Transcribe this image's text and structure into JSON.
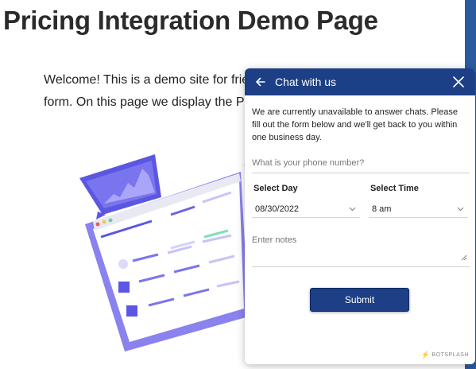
{
  "page": {
    "title": "Pricing Integration Demo Page",
    "intro_line1": "Welcome! This is a demo site for frie",
    "intro_line2": "form. On this page we display the Pr"
  },
  "chat": {
    "title": "Chat with us",
    "message": "We are currently unavailable to answer chats. Please fill out the form below and we'll get back to you within one business day.",
    "phone_placeholder": "What is your phone number?",
    "day_label": "Select Day",
    "day_value": "08/30/2022",
    "time_label": "Select Time",
    "time_value": "8 am",
    "notes_placeholder": "Enter notes",
    "submit_label": "Submit",
    "branding": "BOTSPLASH"
  },
  "icons": {
    "back": "back-arrow-icon",
    "close": "close-icon",
    "dropdown": "chevron-down-icon",
    "brand": "bolt-icon"
  },
  "colors": {
    "header": "#1c3f86",
    "accent": "#5b57e3",
    "side_strip": "#2b5a9e"
  }
}
